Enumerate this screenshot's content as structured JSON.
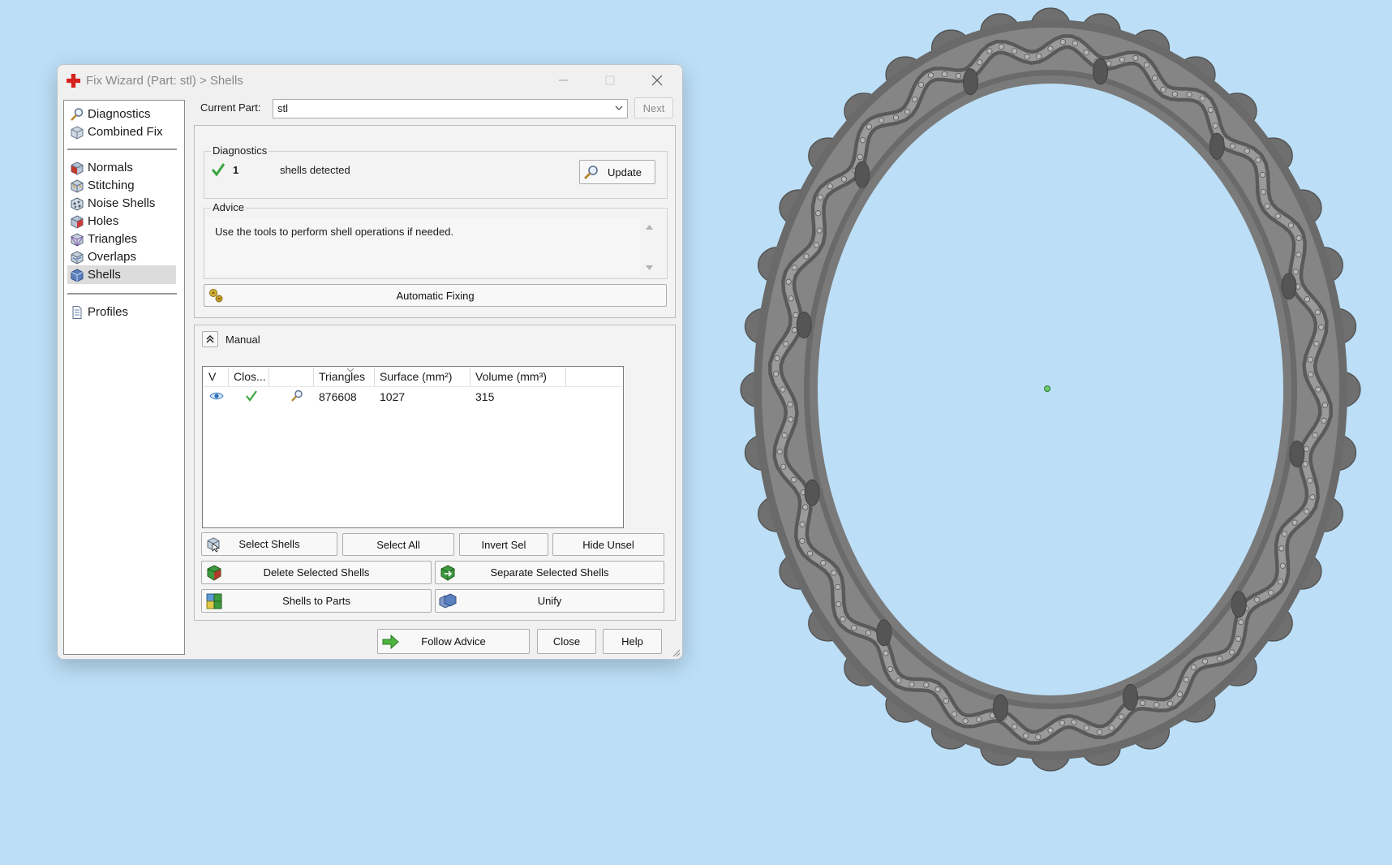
{
  "window": {
    "title": "Fix Wizard (Part: stl) > Shells"
  },
  "nav": {
    "items": [
      {
        "label": "Diagnostics",
        "icon": "magnifier-icon"
      },
      {
        "label": "Combined Fix",
        "icon": "cube-icon"
      },
      {
        "label": "Normals",
        "icon": "normals-cube-icon"
      },
      {
        "label": "Stitching",
        "icon": "stitching-cube-icon"
      },
      {
        "label": "Noise Shells",
        "icon": "noise-shells-icon"
      },
      {
        "label": "Holes",
        "icon": "holes-cube-icon"
      },
      {
        "label": "Triangles",
        "icon": "triangles-cube-icon"
      },
      {
        "label": "Overlaps",
        "icon": "overlaps-cube-icon"
      },
      {
        "label": "Shells",
        "icon": "shells-cube-icon",
        "selected": true
      },
      {
        "label": "Profiles",
        "icon": "document-icon"
      }
    ]
  },
  "current_part": {
    "label": "Current Part:",
    "value": "stl",
    "next_label": "Next"
  },
  "diagnostics": {
    "legend": "Diagnostics",
    "count": "1",
    "status_text": "shells detected",
    "update_label": "Update"
  },
  "advice": {
    "legend": "Advice",
    "text": "Use the tools to perform shell operations if needed.",
    "automatic_fixing_label": "Automatic Fixing"
  },
  "manual": {
    "label": "Manual",
    "columns": [
      "V",
      "Clos...",
      "",
      "Triangles",
      "Surface (mm²)",
      "Volume (mm³)"
    ],
    "rows": [
      {
        "triangles": "876608",
        "surface": "1027",
        "volume": "315"
      }
    ],
    "buttons": {
      "select_shells": "Select Shells",
      "select_all": "Select All",
      "invert_sel": "Invert Sel",
      "hide_unsel": "Hide Unsel",
      "delete_selected": "Delete Selected Shells",
      "separate_selected": "Separate Selected Shells",
      "shells_to_parts": "Shells to Parts",
      "unify": "Unify"
    }
  },
  "footer": {
    "follow_advice": "Follow Advice",
    "close": "Close",
    "help": "Help"
  },
  "colors": {
    "background": "#bcdff7",
    "model_gray": "#7b7b7b",
    "check_green": "#3aa640"
  }
}
